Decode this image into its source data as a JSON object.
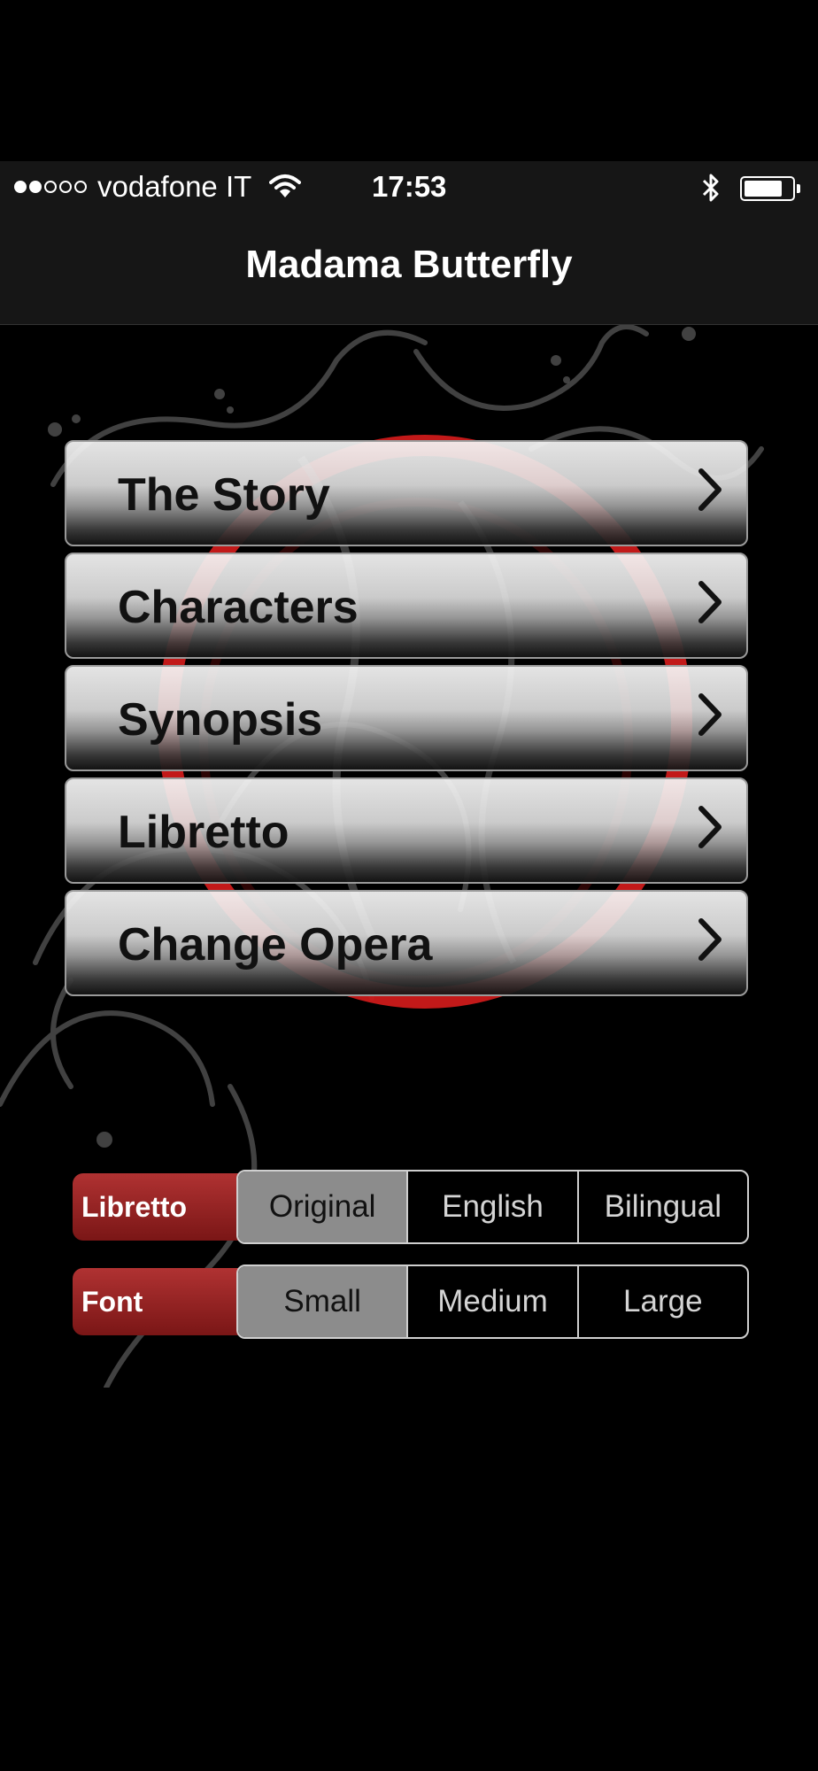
{
  "status_bar": {
    "carrier": "vodafone IT",
    "time": "17:53",
    "signal_bars_filled": 2,
    "signal_bars_total": 5,
    "battery_level": 0.8,
    "icons": [
      "wifi-icon",
      "bluetooth-icon",
      "battery-icon"
    ]
  },
  "nav": {
    "title": "Madama Butterfly"
  },
  "menu": {
    "items": [
      {
        "label": "The Story"
      },
      {
        "label": "Characters"
      },
      {
        "label": "Synopsis"
      },
      {
        "label": "Libretto"
      },
      {
        "label": "Change Opera"
      }
    ]
  },
  "settings": {
    "libretto": {
      "label": "Libretto",
      "options": [
        "Original",
        "English",
        "Bilingual"
      ],
      "selected": "Original"
    },
    "font": {
      "label": "Font",
      "options": [
        "Small",
        "Medium",
        "Large"
      ],
      "selected": "Small"
    }
  },
  "colors": {
    "background": "#000000",
    "bar": "#161616",
    "accent_red": "#b03232",
    "ornament": "#cc1a1a"
  }
}
